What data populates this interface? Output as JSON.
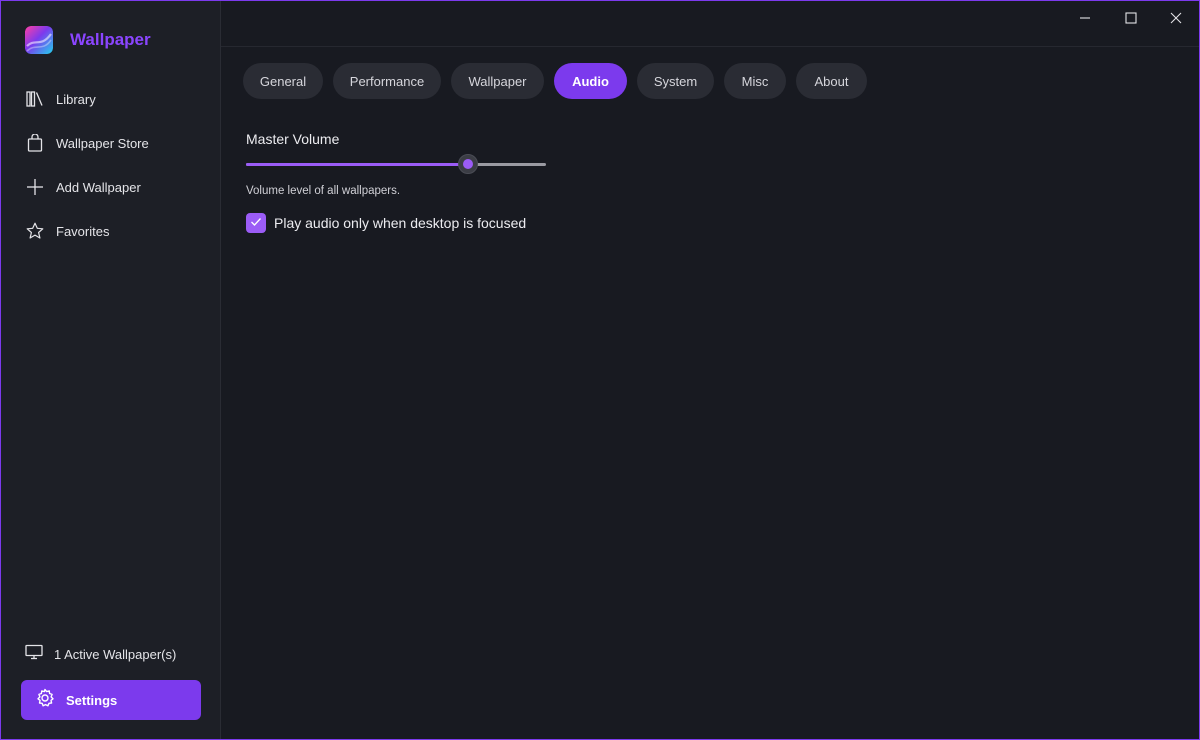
{
  "app": {
    "title": "Wallpaper",
    "accent": "#7c3aed"
  },
  "sidebar": {
    "items": [
      {
        "label": "Library",
        "icon": "library-icon"
      },
      {
        "label": "Wallpaper Store",
        "icon": "shopping-bag-icon"
      },
      {
        "label": "Add Wallpaper",
        "icon": "plus-icon"
      },
      {
        "label": "Favorites",
        "icon": "star-icon"
      }
    ],
    "active_wallpapers": {
      "label": "1 Active Wallpaper(s)",
      "icon": "monitor-icon"
    },
    "settings": {
      "label": "Settings",
      "icon": "gear-icon"
    }
  },
  "titlebar": {
    "minimize": "minimize-icon",
    "maximize": "maximize-icon",
    "close": "close-icon"
  },
  "tabs": [
    {
      "label": "General",
      "active": false
    },
    {
      "label": "Performance",
      "active": false
    },
    {
      "label": "Wallpaper",
      "active": false
    },
    {
      "label": "Audio",
      "active": true
    },
    {
      "label": "System",
      "active": false
    },
    {
      "label": "Misc",
      "active": false
    },
    {
      "label": "About",
      "active": false
    }
  ],
  "audio": {
    "master_volume_label": "Master Volume",
    "master_volume_value": 0.74,
    "master_volume_description": "Volume level of all wallpapers.",
    "focus_only_label": "Play audio only when desktop is focused",
    "focus_only_checked": true
  }
}
